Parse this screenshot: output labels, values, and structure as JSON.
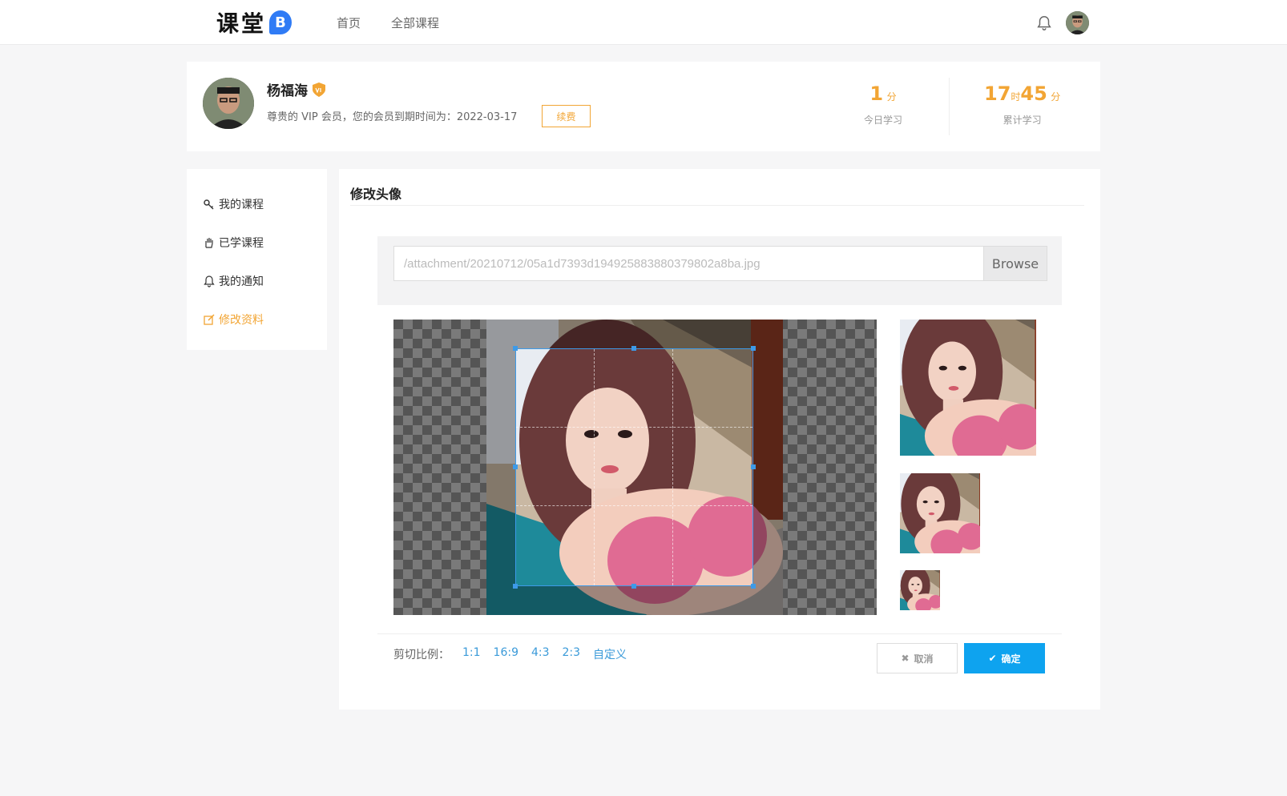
{
  "header": {
    "logo_text": "课堂",
    "logo_badge": "B",
    "nav": [
      "首页",
      "全部课程"
    ]
  },
  "profile": {
    "name": "杨福海",
    "desc": "尊贵的 VIP 会员，您的会员到期时间为：2022-03-17",
    "renew_label": "续费",
    "today": {
      "num": "1",
      "unit": "分",
      "label": "今日学习"
    },
    "total": {
      "hours": "17",
      "hours_unit": "时",
      "mins": "45",
      "mins_unit": "分",
      "label": "累计学习"
    }
  },
  "sidebar": {
    "items": [
      {
        "label": "我的课程",
        "icon": "key-icon"
      },
      {
        "label": "已学课程",
        "icon": "hand-icon"
      },
      {
        "label": "我的通知",
        "icon": "bell-icon"
      },
      {
        "label": "修改资料",
        "icon": "edit-icon",
        "active": true
      }
    ]
  },
  "main": {
    "title": "修改头像",
    "file_path": "/attachment/20210712/05a1d7393d194925883880379802a8ba.jpg",
    "browse_label": "Browse",
    "ratio_label": "剪切比例：",
    "ratios": [
      "1:1",
      "16:9",
      "4:3",
      "2:3",
      "自定义"
    ],
    "cancel_label": "取消",
    "ok_label": "确定"
  },
  "colors": {
    "accent": "#f2a534",
    "primary": "#0ea3ef",
    "crop": "#3d9ae8"
  }
}
